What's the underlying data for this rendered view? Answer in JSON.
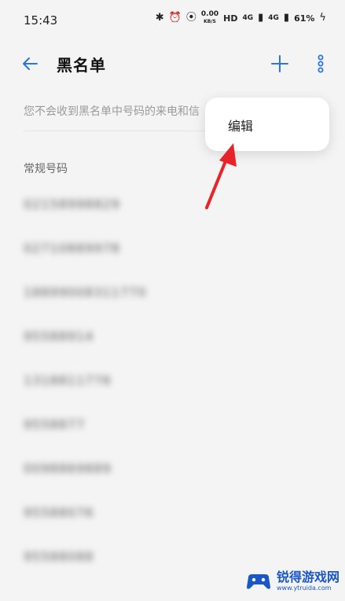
{
  "status": {
    "time": "15:43",
    "speed_value": "0.00",
    "speed_unit": "KB/S",
    "hd": "HD",
    "net_tag_1": "4G",
    "net_tag_2": "4G",
    "battery": "61%"
  },
  "header": {
    "title": "黑名单"
  },
  "hint": "您不会收到黑名单中号码的来电和信",
  "section_title": "常规号码",
  "numbers": [
    "02158998829",
    "02710889978",
    "18899008311770",
    "95588914",
    "1318811776",
    "9558877",
    "0098869889",
    "95588076",
    "95588088"
  ],
  "menu": {
    "edit_label": "编辑"
  },
  "watermark": {
    "title": "锐得游戏网",
    "url": "www.ytruida.com"
  },
  "colors": {
    "accent": "#2b73e8",
    "annotation_red": "#e8242a",
    "watermark_blue": "#1a56c8"
  }
}
